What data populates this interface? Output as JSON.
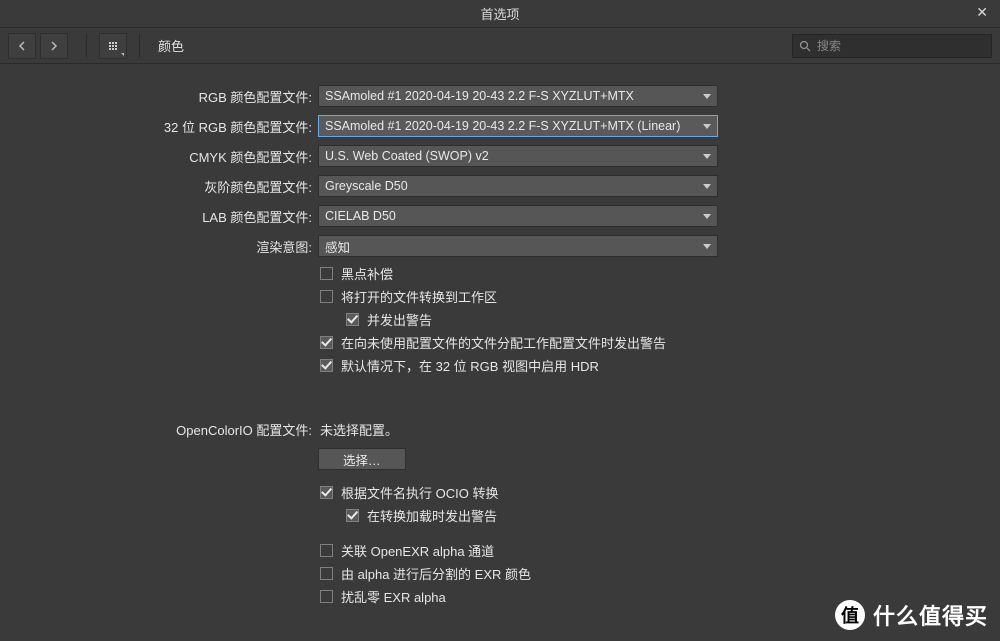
{
  "window": {
    "title": "首选项"
  },
  "toolbar": {
    "breadcrumb": "颜色",
    "search_placeholder": "搜索"
  },
  "fields": {
    "rgb": {
      "label": "RGB 颜色配置文件:",
      "value": "SSAmoled #1 2020-04-19 20-43 2.2 F-S XYZLUT+MTX"
    },
    "rgb32": {
      "label": "32 位 RGB 颜色配置文件:",
      "value": "SSAmoled #1 2020-04-19 20-43 2.2 F-S XYZLUT+MTX (Linear)"
    },
    "cmyk": {
      "label": "CMYK 颜色配置文件:",
      "value": "U.S. Web Coated (SWOP) v2"
    },
    "grey": {
      "label": "灰阶颜色配置文件:",
      "value": "Greyscale D50"
    },
    "lab": {
      "label": "LAB 颜色配置文件:",
      "value": "CIELAB D50"
    },
    "intent": {
      "label": "渲染意图:",
      "value": "感知"
    }
  },
  "checks": {
    "blackpoint": "黑点补偿",
    "convert_open": "将打开的文件转换到工作区",
    "convert_warn": "并发出警告",
    "assign_warn": "在向未使用配置文件的文件分配工作配置文件时发出警告",
    "hdr_default": "默认情况下，在 32 位 RGB 视图中启用 HDR"
  },
  "ocio": {
    "label": "OpenColorIO 配置文件:",
    "value": "未选择配置。",
    "select_btn": "选择…",
    "by_filename": "根据文件名执行 OCIO 转换",
    "warn_load": "在转换加载时发出警告",
    "exr_alpha": "关联 OpenEXR alpha 通道",
    "exr_split": "由 alpha 进行后分割的 EXR 颜色",
    "exr_dither": "扰乱零 EXR alpha"
  },
  "watermark": {
    "badge": "值",
    "text": "什么值得买"
  }
}
